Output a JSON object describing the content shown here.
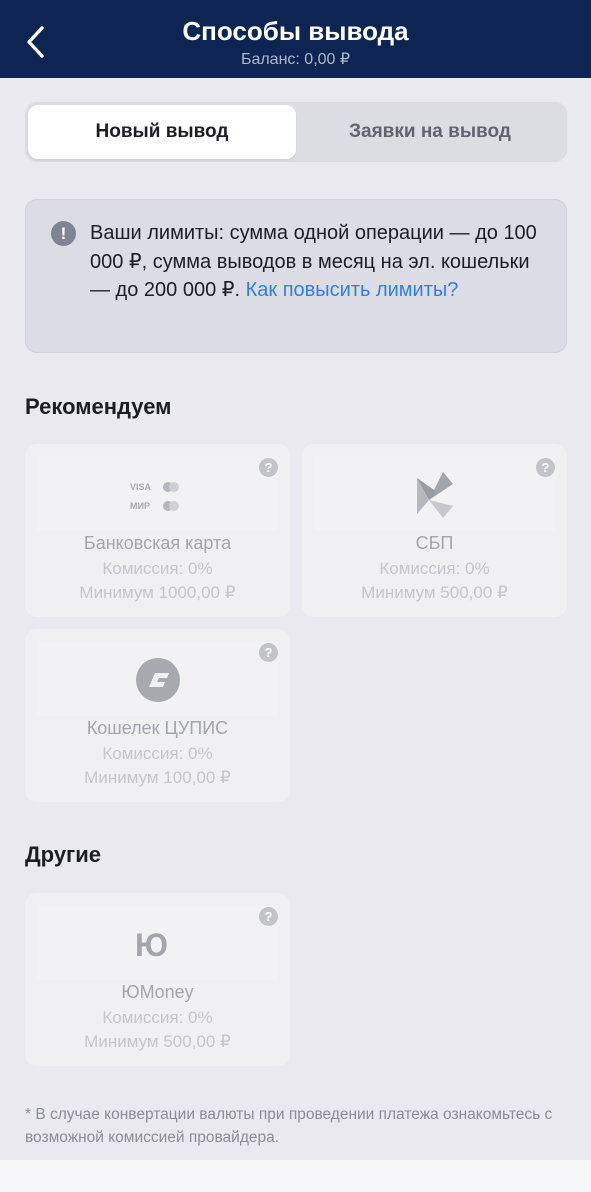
{
  "header": {
    "title": "Способы вывода",
    "subtitle": "Баланс: 0,00 ₽"
  },
  "tabs": [
    {
      "label": "Новый вывод",
      "active": true
    },
    {
      "label": "Заявки на вывод",
      "active": false
    }
  ],
  "info": {
    "icon": "exclamation-icon",
    "text": "Ваши лимиты: сумма одной операции — до 100 000 ₽, сумма выводов в месяц на эл. кошельки — до 200 000 ₽. ",
    "link": "Как повысить лимиты?"
  },
  "sections": {
    "recommended": {
      "title": "Рекомендуем",
      "items": [
        {
          "name": "Банковская карта",
          "fee": "Комиссия: 0%",
          "min": "Минимум 1000,00 ₽",
          "icon": "visa-mir-cards-icon",
          "logo_text": [
            "VISA",
            "МИР"
          ]
        },
        {
          "name": "СБП",
          "fee": "Комиссия: 0%",
          "min": "Минимум 500,00 ₽",
          "icon": "sbp-icon"
        },
        {
          "name": "Кошелек ЦУПИС",
          "fee": "Комиссия: 0%",
          "min": "Минимум 100,00 ₽",
          "icon": "cupis-icon"
        }
      ]
    },
    "other": {
      "title": "Другие",
      "items": [
        {
          "name": "ЮMoney",
          "fee": "Комиссия: 0%",
          "min": "Минимум 500,00 ₽",
          "icon": "yumoney-icon",
          "logo_text": "Ю"
        }
      ]
    }
  },
  "help_glyph": "?",
  "footnote": "* В случае конвертации валюты при проведении платежа ознакомьтесь с возможной комиссией провайдера.",
  "colors": {
    "header_bg": "#0e2452",
    "page_bg": "#e9e9ef",
    "link": "#2f7fe0"
  }
}
